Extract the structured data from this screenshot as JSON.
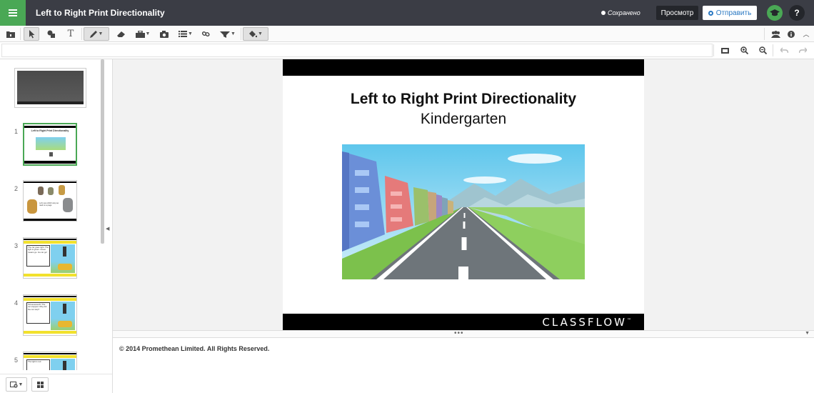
{
  "header": {
    "title": "Left to Right Print Directionality",
    "saved_status": "Сохранено",
    "preview_label": "Просмотр",
    "send_label": "Отправить",
    "help_label": "?"
  },
  "toolbar": {
    "left_icons": [
      "folder-icon",
      "select-pointer-icon",
      "shapes-icon",
      "text-icon",
      "pen-icon",
      "eraser-icon",
      "toolbox-icon",
      "camera-icon",
      "list-icon",
      "link-icon",
      "reveal-icon",
      "fill-bucket-icon"
    ],
    "right_icons": [
      "participants-icon",
      "info-icon",
      "collapse-up-icon"
    ],
    "view_icons": [
      "fit-screen-icon",
      "zoom-in-icon",
      "zoom-out-icon",
      "undo-icon",
      "redo-icon"
    ]
  },
  "thumbnails": [
    {
      "number": "",
      "caption": ""
    },
    {
      "number": "1",
      "caption": "Left to Right Print Directionality"
    },
    {
      "number": "2",
      "caption": ""
    },
    {
      "number": "3",
      "caption": "The car goes right. The light is green. Green means go. Go car go!"
    },
    {
      "number": "4",
      "caption": "Screeeeeeech! The car stopped. Why did the car stop?"
    },
    {
      "number": "5",
      "caption": "The light is red."
    }
  ],
  "slide": {
    "title": "Left to Right Print Directionality",
    "subtitle": "Kindergarten",
    "brand": "CLASSFLOW",
    "brand_mark": "™"
  },
  "notes": {
    "copyright": "© 2014 Promethean Limited. All Rights Reserved."
  },
  "colors": {
    "header_bg": "#3b3d45",
    "accent_green": "#4aa855",
    "send_blue": "#2a78c2"
  }
}
